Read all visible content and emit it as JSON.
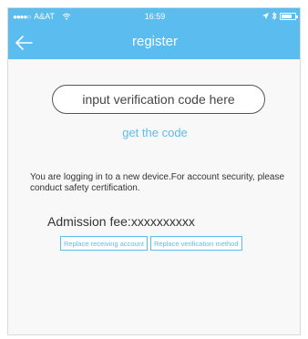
{
  "status_bar": {
    "signal_dots": "●●●●○",
    "carrier": "A&AT",
    "wifi_icon": "wifi-icon",
    "time": "16:59",
    "location_icon": "location-arrow-icon",
    "bluetooth_icon": "bluetooth-icon",
    "battery_icon": "battery-icon"
  },
  "nav": {
    "back_icon": "back-arrow-icon",
    "title": "register"
  },
  "form": {
    "code_input": {
      "placeholder": "input verification code here",
      "value": ""
    },
    "get_code_label": "get the code"
  },
  "notice_text": "You are logging in to a new device.For account security, please conduct safety certification.",
  "fee": {
    "label": "Admission fee:",
    "value": "xxxxxxxxxx"
  },
  "buttons": {
    "replace_account": "Replace receiving account",
    "replace_method": "Replace verification method"
  },
  "colors": {
    "accent": "#5bbcf0",
    "background": "#f8f8f8"
  }
}
